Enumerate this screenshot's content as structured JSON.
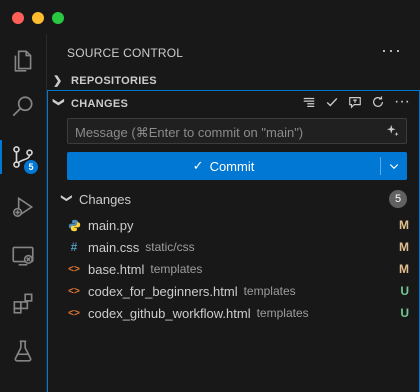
{
  "activity_bar": {
    "scm_badge": "5"
  },
  "sidebar": {
    "title": "SOURCE CONTROL",
    "more": "···"
  },
  "sections": {
    "repositories": "REPOSITORIES",
    "changes": "CHANGES"
  },
  "commit_input": {
    "placeholder": "Message (⌘Enter to commit on \"main\")",
    "value": ""
  },
  "commit_button": {
    "label": "Commit",
    "check": "✓",
    "dropdown": "⌄"
  },
  "changes_group": {
    "label": "Changes",
    "count": "5"
  },
  "files": [
    {
      "name": "main.py",
      "dir": "",
      "status": "M",
      "icon": "python-icon"
    },
    {
      "name": "main.css",
      "dir": "static/css",
      "status": "M",
      "icon": "css-hash-icon"
    },
    {
      "name": "base.html",
      "dir": "templates",
      "status": "M",
      "icon": "html-icon"
    },
    {
      "name": "codex_for_beginners.html",
      "dir": "templates",
      "status": "U",
      "icon": "html-icon"
    },
    {
      "name": "codex_github_workflow.html",
      "dir": "templates",
      "status": "U",
      "icon": "html-icon"
    }
  ],
  "colors": {
    "accent": "#0078d4",
    "modified": "#e2c08d",
    "untracked": "#73c991"
  }
}
